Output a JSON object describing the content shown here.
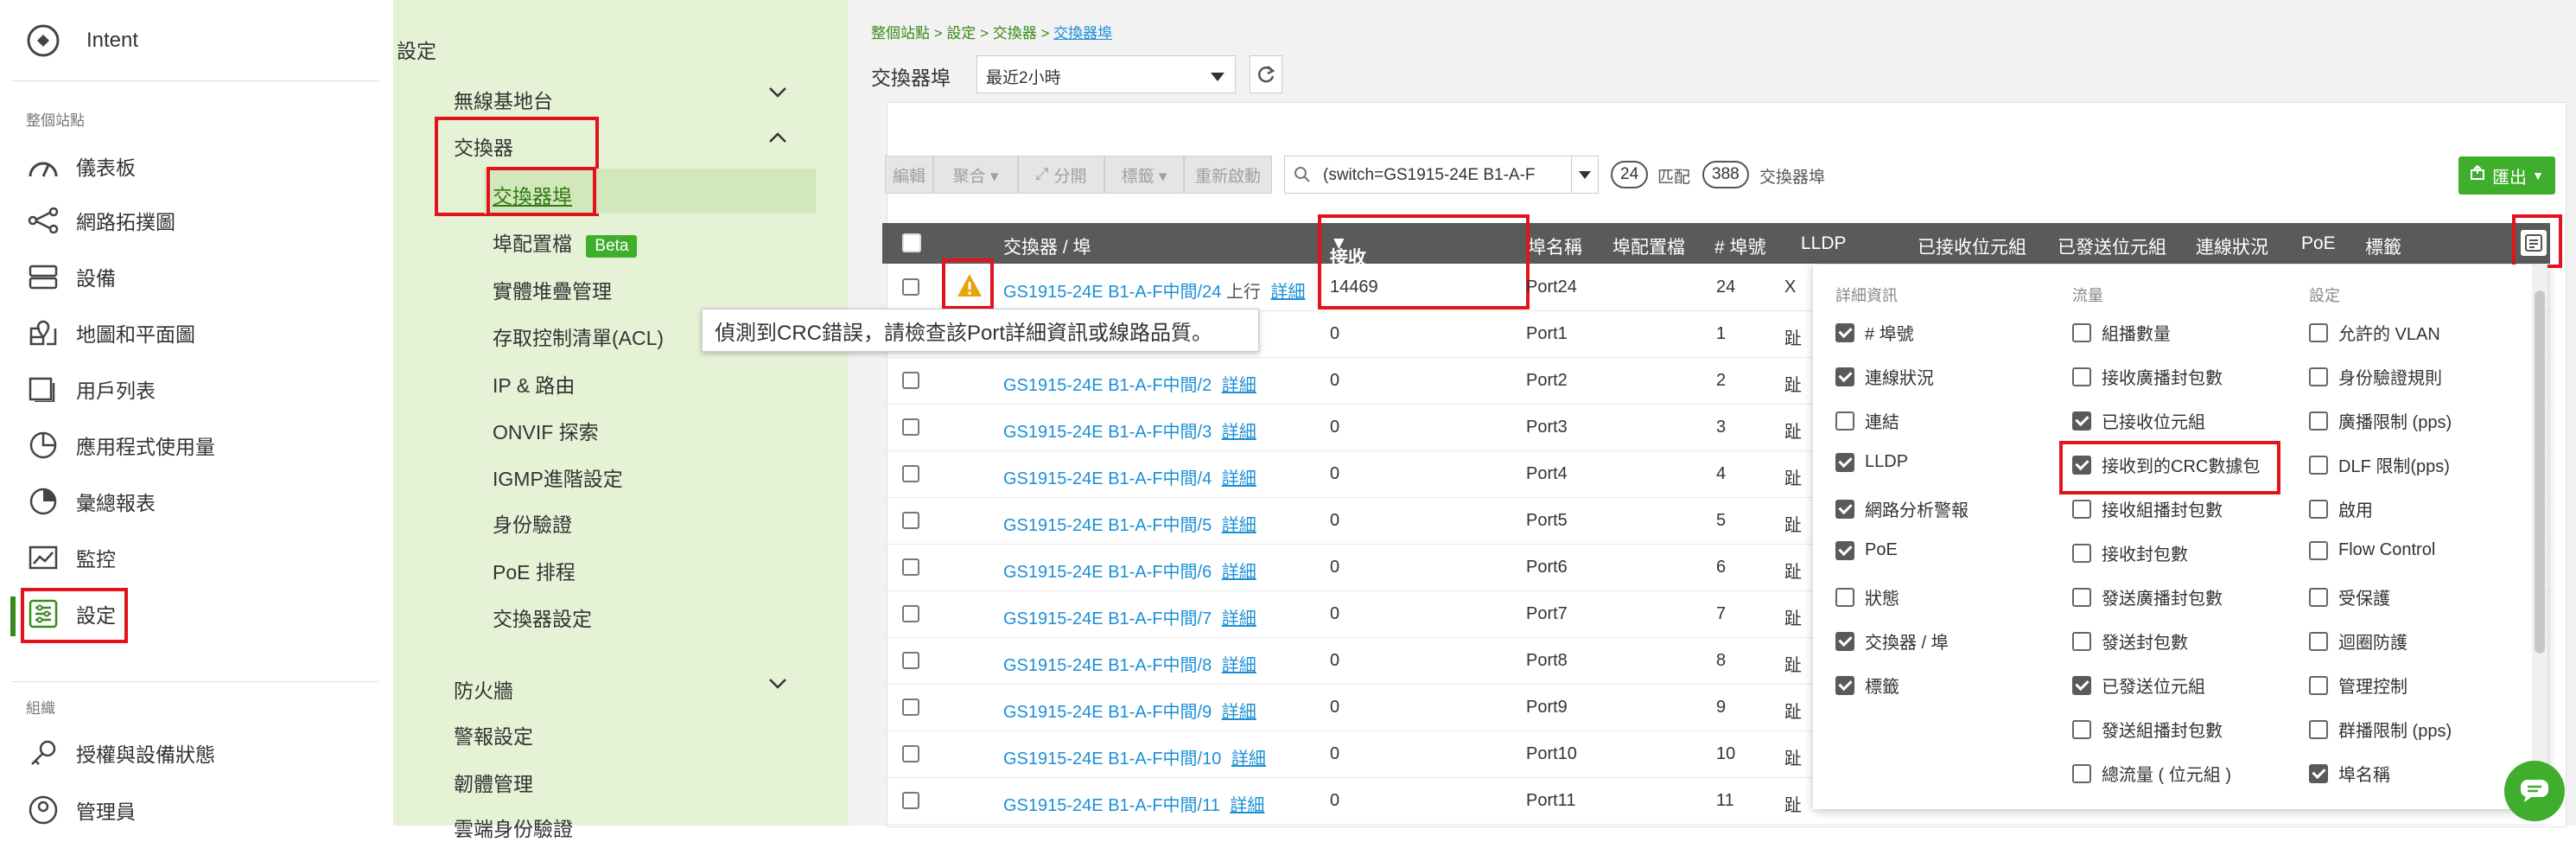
{
  "app": {
    "name": "Intent"
  },
  "leftnav": {
    "section1": "整個站點",
    "items": [
      {
        "label": "儀表板",
        "icon": "dashboard-icon"
      },
      {
        "label": "網路拓撲圖",
        "icon": "topology-icon"
      },
      {
        "label": "設備",
        "icon": "devices-icon"
      },
      {
        "label": "地圖和平面圖",
        "icon": "map-icon"
      },
      {
        "label": "用戶列表",
        "icon": "users-icon"
      },
      {
        "label": "應用程式使用量",
        "icon": "app-usage-icon"
      },
      {
        "label": "彙總報表",
        "icon": "report-icon"
      },
      {
        "label": "監控",
        "icon": "monitor-icon"
      },
      {
        "label": "設定",
        "icon": "settings-icon"
      }
    ],
    "section2": "組織",
    "org_items": [
      {
        "label": "授權與設備狀態",
        "icon": "license-icon"
      },
      {
        "label": "管理員",
        "icon": "admin-icon"
      }
    ]
  },
  "settings": {
    "title": "設定",
    "groups": [
      {
        "label": "無線基地台"
      },
      {
        "label": "交換器"
      }
    ],
    "switch_items": [
      "交換器埠",
      "埠配置檔",
      "實體堆疊管理",
      "存取控制清單(ACL)",
      "IP & 路由",
      "ONVIF 探索",
      "IGMP進階設定",
      "身份驗證",
      "PoE 排程",
      "交換器設定"
    ],
    "beta_badge": "Beta",
    "after_groups": [
      "防火牆",
      "警報設定",
      "韌體管理",
      "雲端身份驗證"
    ]
  },
  "breadcrumb": {
    "root": "整個站點",
    "sep1": " > ",
    "mid": "設定",
    "sep2": " > ",
    "mid2": "交換器",
    "sep3": " > ",
    "current": "交換器埠"
  },
  "header": {
    "title": "交換器埠",
    "time_range": "最近2小時"
  },
  "toolbar": {
    "edit": "編輯",
    "aggregate": "聚合 ▾",
    "split": "分開",
    "tags": "標籤 ▾",
    "restart": "重新啟動",
    "search_value": "(switch=GS1915-24E B1-A-F",
    "match_count": "24",
    "match_label": "匹配",
    "total_count": "388",
    "total_label": "交換器埠",
    "export": "匯出"
  },
  "table": {
    "columns": [
      "交換器 / 埠",
      "接收到的CRC數據包",
      "埠名稱",
      "埠配置檔",
      "# 埠號",
      "LLDP",
      "已接收位元組",
      "已發送位元組",
      "連線狀況",
      "PoE",
      "標籤"
    ],
    "link_text": "詳細",
    "uplink": "上行",
    "rows": [
      {
        "switch": "GS1915-24E B1-A-F中間/24",
        "crc": "14469",
        "port": "Port24",
        "num": "24",
        "extra": "X"
      },
      {
        "switch": "GS1915-24E B1-A-F中間/1",
        "crc": "0",
        "port": "Port1",
        "num": "1",
        "extra": "趾"
      },
      {
        "switch": "GS1915-24E B1-A-F中間/2",
        "crc": "0",
        "port": "Port2",
        "num": "2",
        "extra": "趾"
      },
      {
        "switch": "GS1915-24E B1-A-F中間/3",
        "crc": "0",
        "port": "Port3",
        "num": "3",
        "extra": "趾"
      },
      {
        "switch": "GS1915-24E B1-A-F中間/4",
        "crc": "0",
        "port": "Port4",
        "num": "4",
        "extra": "趾"
      },
      {
        "switch": "GS1915-24E B1-A-F中間/5",
        "crc": "0",
        "port": "Port5",
        "num": "5",
        "extra": "趾"
      },
      {
        "switch": "GS1915-24E B1-A-F中間/6",
        "crc": "0",
        "port": "Port6",
        "num": "6",
        "extra": "趾"
      },
      {
        "switch": "GS1915-24E B1-A-F中間/7",
        "crc": "0",
        "port": "Port7",
        "num": "7",
        "extra": "趾"
      },
      {
        "switch": "GS1915-24E B1-A-F中間/8",
        "crc": "0",
        "port": "Port8",
        "num": "8",
        "extra": "趾"
      },
      {
        "switch": "GS1915-24E B1-A-F中間/9",
        "crc": "0",
        "port": "Port9",
        "num": "9",
        "extra": "趾"
      },
      {
        "switch": "GS1915-24E B1-A-F中間/10",
        "crc": "0",
        "port": "Port10",
        "num": "10",
        "extra": "趾"
      },
      {
        "switch": "GS1915-24E B1-A-F中間/11",
        "crc": "0",
        "port": "Port11",
        "num": "11",
        "extra": "趾"
      }
    ]
  },
  "tooltip": "偵測到CRC錯誤，請檢查該Port詳細資訊或線路品質。",
  "column_panel": {
    "detail_title": "詳細資訊",
    "traffic_title": "流量",
    "settings_title": "設定",
    "detail": [
      {
        "label": "# 埠號",
        "checked": true
      },
      {
        "label": "連線狀況",
        "checked": true
      },
      {
        "label": "連結",
        "checked": false
      },
      {
        "label": "LLDP",
        "checked": true
      },
      {
        "label": "網路分析警報",
        "checked": true
      },
      {
        "label": "PoE",
        "checked": true
      },
      {
        "label": "狀態",
        "checked": false
      },
      {
        "label": "交換器 / 埠",
        "checked": true
      },
      {
        "label": "標籤",
        "checked": true
      }
    ],
    "traffic": [
      {
        "label": "組播數量",
        "checked": false
      },
      {
        "label": "接收廣播封包數",
        "checked": false
      },
      {
        "label": "已接收位元組",
        "checked": true
      },
      {
        "label": "接收到的CRC數據包",
        "checked": true
      },
      {
        "label": "接收組播封包數",
        "checked": false
      },
      {
        "label": "接收封包數",
        "checked": false
      },
      {
        "label": "發送廣播封包數",
        "checked": false
      },
      {
        "label": "發送封包數",
        "checked": false
      },
      {
        "label": "已發送位元組",
        "checked": true
      },
      {
        "label": "發送組播封包數",
        "checked": false
      },
      {
        "label": "總流量 ( 位元組 )",
        "checked": false
      }
    ],
    "settings": [
      {
        "label": "允許的 VLAN",
        "checked": false
      },
      {
        "label": "身份驗證規則",
        "checked": false
      },
      {
        "label": "廣播限制 (pps)",
        "checked": false
      },
      {
        "label": "DLF 限制(pps)",
        "checked": false
      },
      {
        "label": "啟用",
        "checked": false
      },
      {
        "label": "Flow Control",
        "checked": false
      },
      {
        "label": "受保護",
        "checked": false
      },
      {
        "label": "迴圈防護",
        "checked": false
      },
      {
        "label": "管理控制",
        "checked": false
      },
      {
        "label": "群播限制 (pps)",
        "checked": false
      },
      {
        "label": "埠名稱",
        "checked": true
      }
    ]
  },
  "colors": {
    "accent": "#3a8a1b",
    "link": "#1a8fd6",
    "highlight": "#e3131b",
    "warning": "#e8a20c"
  }
}
